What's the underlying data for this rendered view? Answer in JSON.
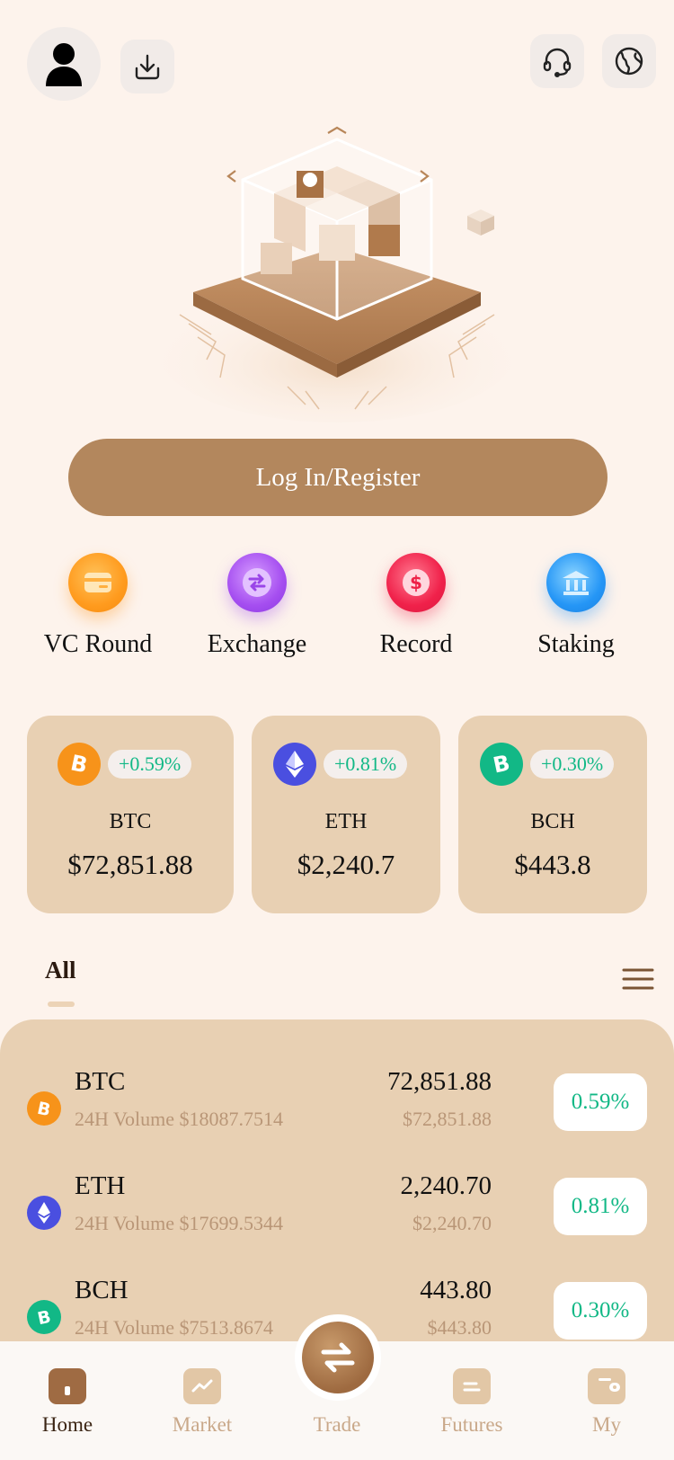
{
  "header": {
    "avatar_icon": "user-icon",
    "download_icon": "download-icon",
    "support_icon": "headset-icon",
    "language_icon": "globe-icon"
  },
  "hero": {
    "image": "isometric-cube-platform-illustration"
  },
  "login": {
    "label": "Log In/Register"
  },
  "quick_actions": [
    {
      "label": "VC Round",
      "icon": "card-icon",
      "color": "#ff9b1e"
    },
    {
      "label": "Exchange",
      "icon": "swap-icon",
      "color": "#a54ef0"
    },
    {
      "label": "Record",
      "icon": "dollar-icon",
      "color": "#f0214a"
    },
    {
      "label": "Staking",
      "icon": "bank-icon",
      "color": "#2596f6"
    }
  ],
  "tickers": [
    {
      "symbol": "BTC",
      "change": "+0.59%",
      "price": "$72,851.88",
      "icon": "bitcoin-icon",
      "color": "#f7931a"
    },
    {
      "symbol": "ETH",
      "change": "+0.81%",
      "price": "$2,240.7",
      "icon": "ethereum-icon",
      "color": "#4a4fe0"
    },
    {
      "symbol": "BCH",
      "change": "+0.30%",
      "price": "$443.8",
      "icon": "bitcoin-cash-icon",
      "color": "#12b886"
    }
  ],
  "tabs": {
    "active": "All",
    "menu_icon": "hamburger-icon"
  },
  "market_list": [
    {
      "symbol": "BTC",
      "volume": "24H Volume $18087.7514",
      "last": "72,851.88",
      "usd": "$72,851.88",
      "change": "0.59%",
      "color": "#f7931a"
    },
    {
      "symbol": "ETH",
      "volume": "24H Volume $17699.5344",
      "last": "2,240.70",
      "usd": "$2,240.70",
      "change": "0.81%",
      "color": "#4a4fe0"
    },
    {
      "symbol": "BCH",
      "volume": "24H Volume $7513.8674",
      "last": "443.80",
      "usd": "$443.80",
      "change": "0.30%",
      "color": "#12b886"
    }
  ],
  "nav": [
    {
      "label": "Home",
      "icon": "home-icon"
    },
    {
      "label": "Market",
      "icon": "chart-icon"
    },
    {
      "label": "Trade",
      "icon": "trade-swap-icon"
    },
    {
      "label": "Futures",
      "icon": "futures-icon"
    },
    {
      "label": "My",
      "icon": "wallet-icon"
    }
  ],
  "colors": {
    "background": "#fdf3ec",
    "accent": "#b3875d",
    "card": "#e8d0b3",
    "positive": "#12b886"
  }
}
